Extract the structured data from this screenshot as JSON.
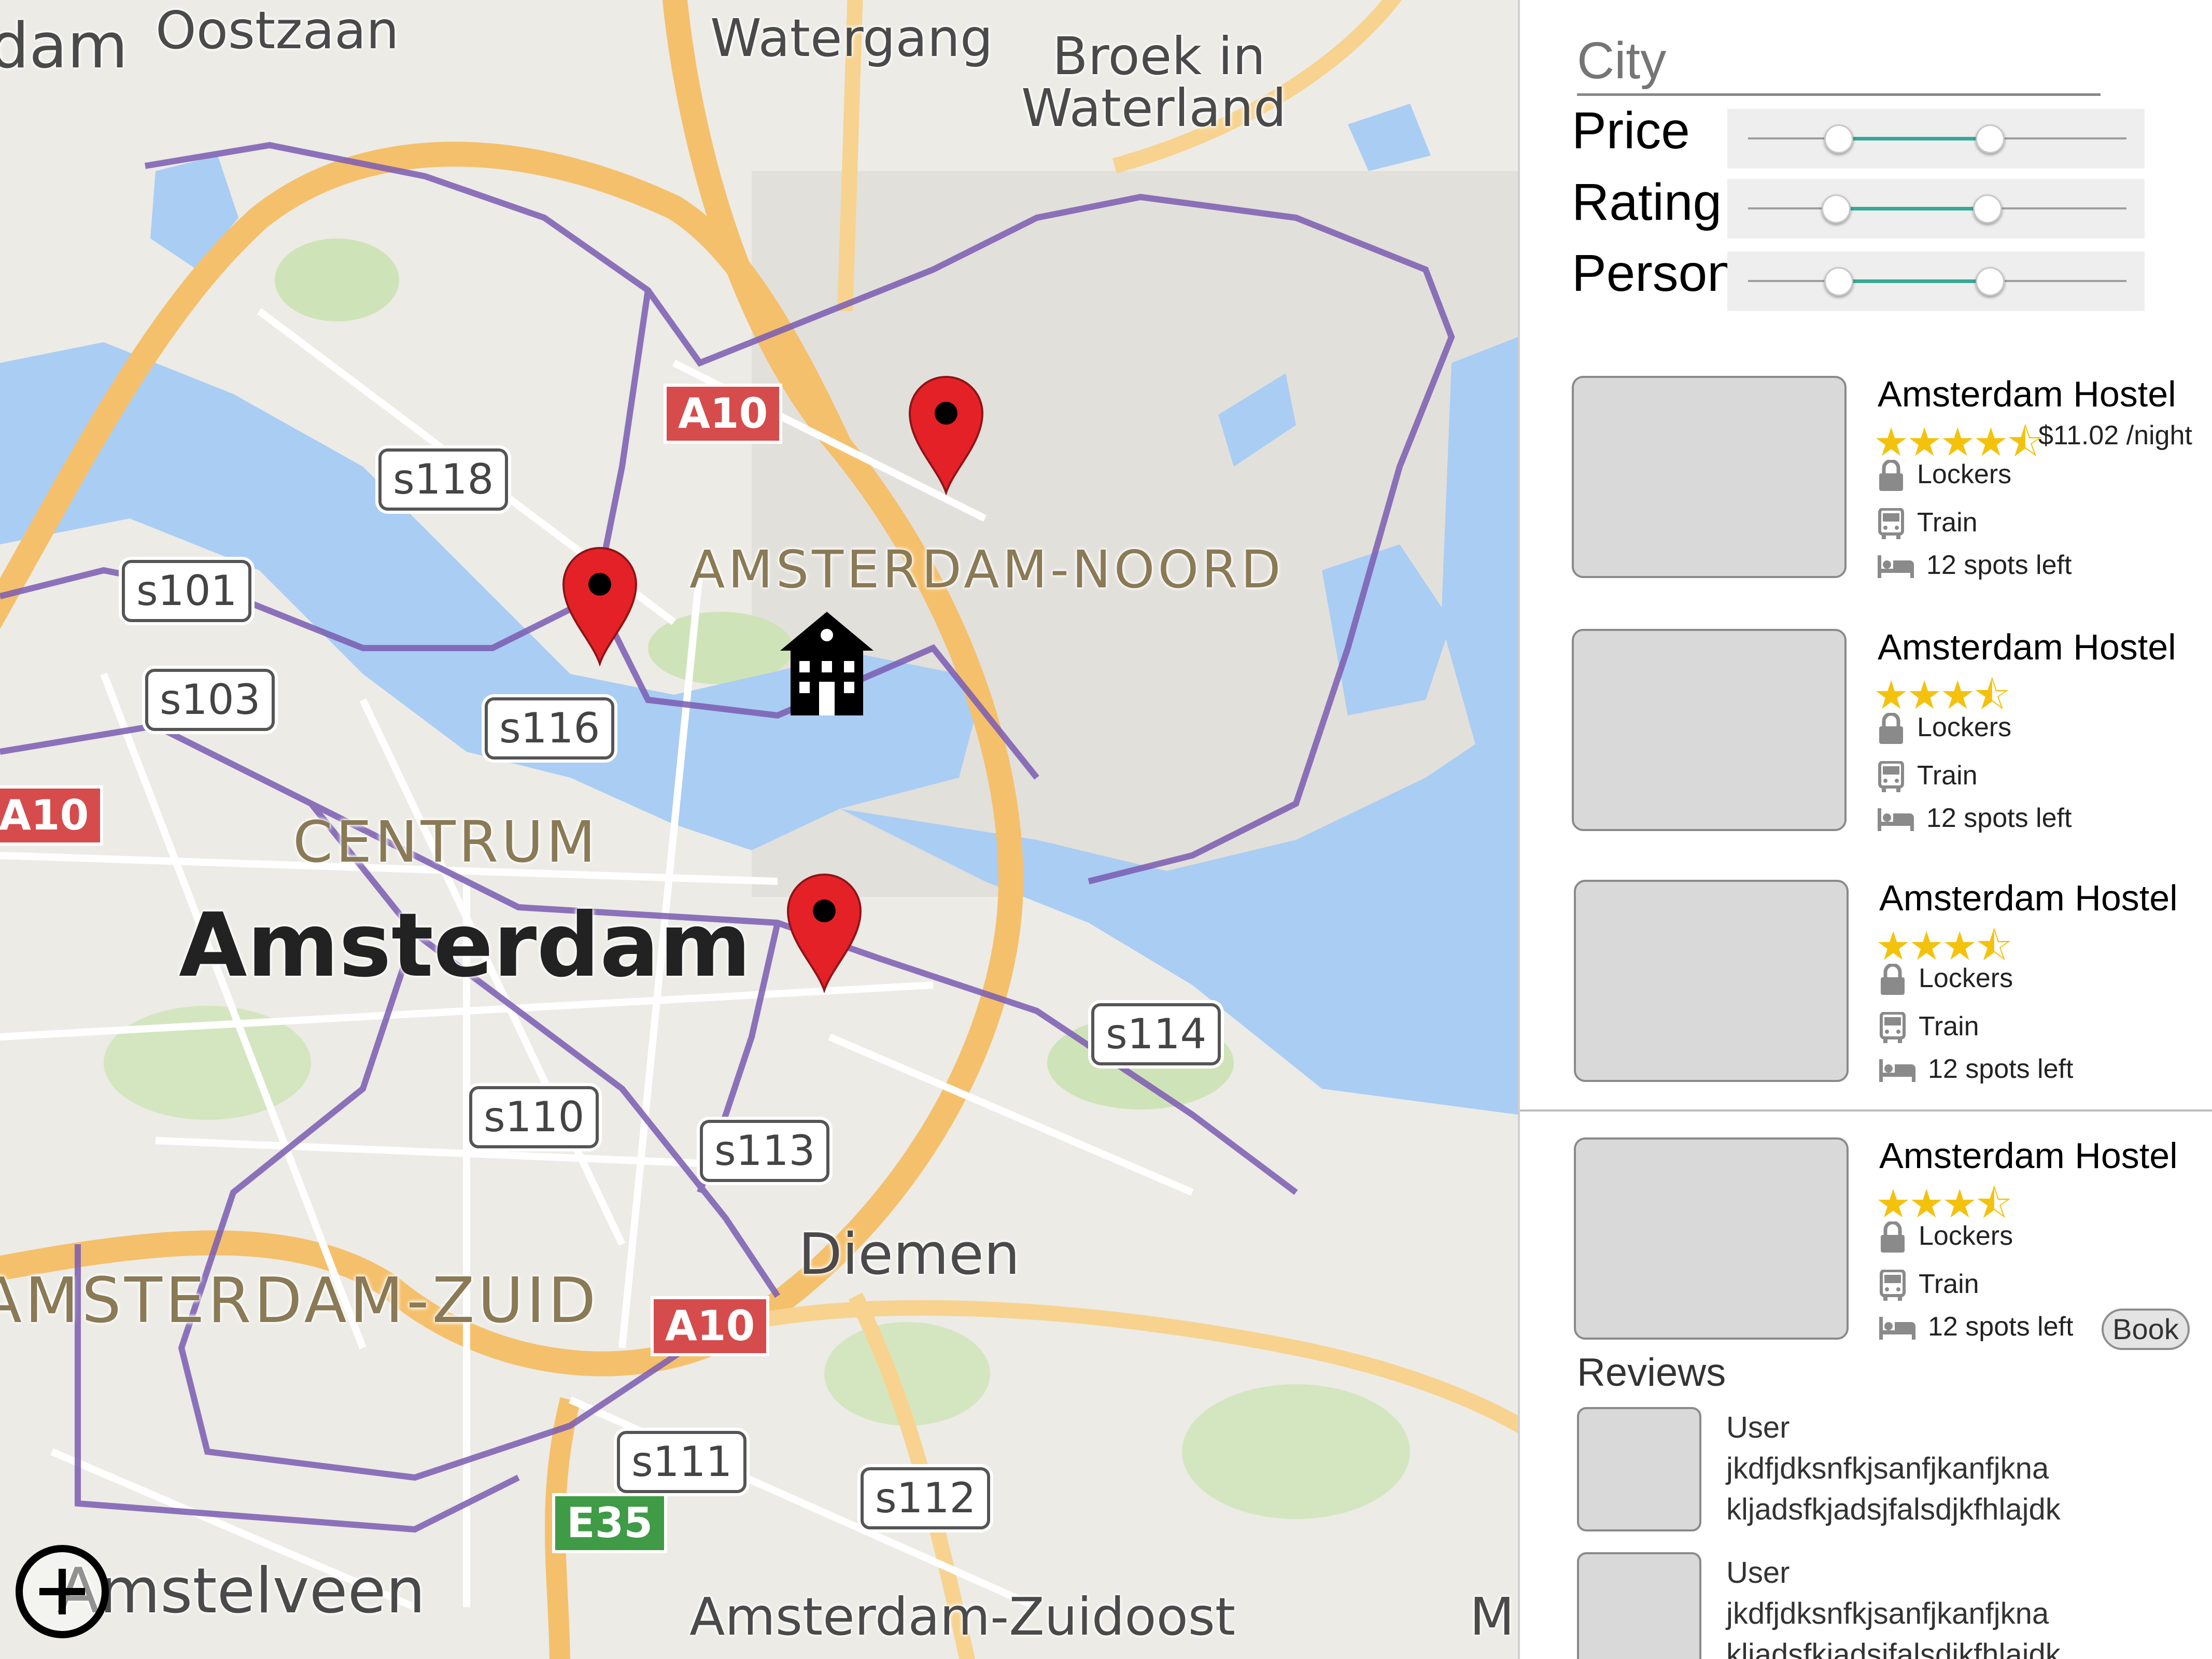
{
  "map": {
    "place_labels": [
      "dam",
      "Oostzaan",
      "Watergang",
      "Broek in",
      "Waterland",
      "AMSTERDAM-NOORD",
      "CENTRUM",
      "Amsterdam",
      "Diemen",
      "AMSTERDAM-ZUID",
      "Amstelveen",
      "Amsterdam-Zuidoost",
      "M"
    ],
    "shields": [
      "s118",
      "s101",
      "s103",
      "s116",
      "s114",
      "s110",
      "s113",
      "s111",
      "s112"
    ],
    "a_roads": [
      "A10",
      "A10",
      "A10"
    ],
    "e_roads": [
      "E35"
    ],
    "markers": [
      "location-pin",
      "location-pin",
      "location-pin"
    ],
    "home_icon": "hostel-building-icon",
    "zoom_icon": "plus-icon",
    "colors": {
      "water": "#aacdf3",
      "boundary": "#7b5cb2",
      "highway": "#f5c06b",
      "pin": "#e52128"
    }
  },
  "filters": {
    "city_placeholder": "City",
    "price_label": "Price",
    "rating_label": "Rating",
    "person_label": "Person",
    "accent": "#36a997"
  },
  "listings": [
    {
      "name": "Amsterdam Hostel",
      "stars": "★★★★⯪",
      "rating": 4.5,
      "price": "$11.02 /night",
      "lockers": "Lockers",
      "transport": "Train",
      "spots": "12 spots left"
    },
    {
      "name": "Amsterdam Hostel",
      "stars": "★★★⯪",
      "rating": 3.5,
      "lockers": "Lockers",
      "transport": "Train",
      "spots": "12 spots left"
    },
    {
      "name": "Amsterdam Hostel",
      "stars": "★★★⯪",
      "rating": 3.5,
      "lockers": "Lockers",
      "transport": "Train",
      "spots": "12 spots left"
    }
  ],
  "detail": {
    "name": "Amsterdam Hostel",
    "stars": "★★★⯪",
    "rating": 3.5,
    "lockers": "Lockers",
    "transport": "Train",
    "spots": "12 spots left",
    "book_label": "Book",
    "reviews_heading": "Reviews",
    "reviews": [
      {
        "user": "User",
        "line1": "jkdfjdksnfkjsanfjkanfjkna",
        "line2": "kljadsfkjadsjfalsdjkfhlajdk"
      },
      {
        "user": "User",
        "line1": "jkdfjdksnfkjsanfjkanfjkna",
        "line2": "kljadsfkjadsjfalsdjkfhlajdk"
      }
    ]
  }
}
